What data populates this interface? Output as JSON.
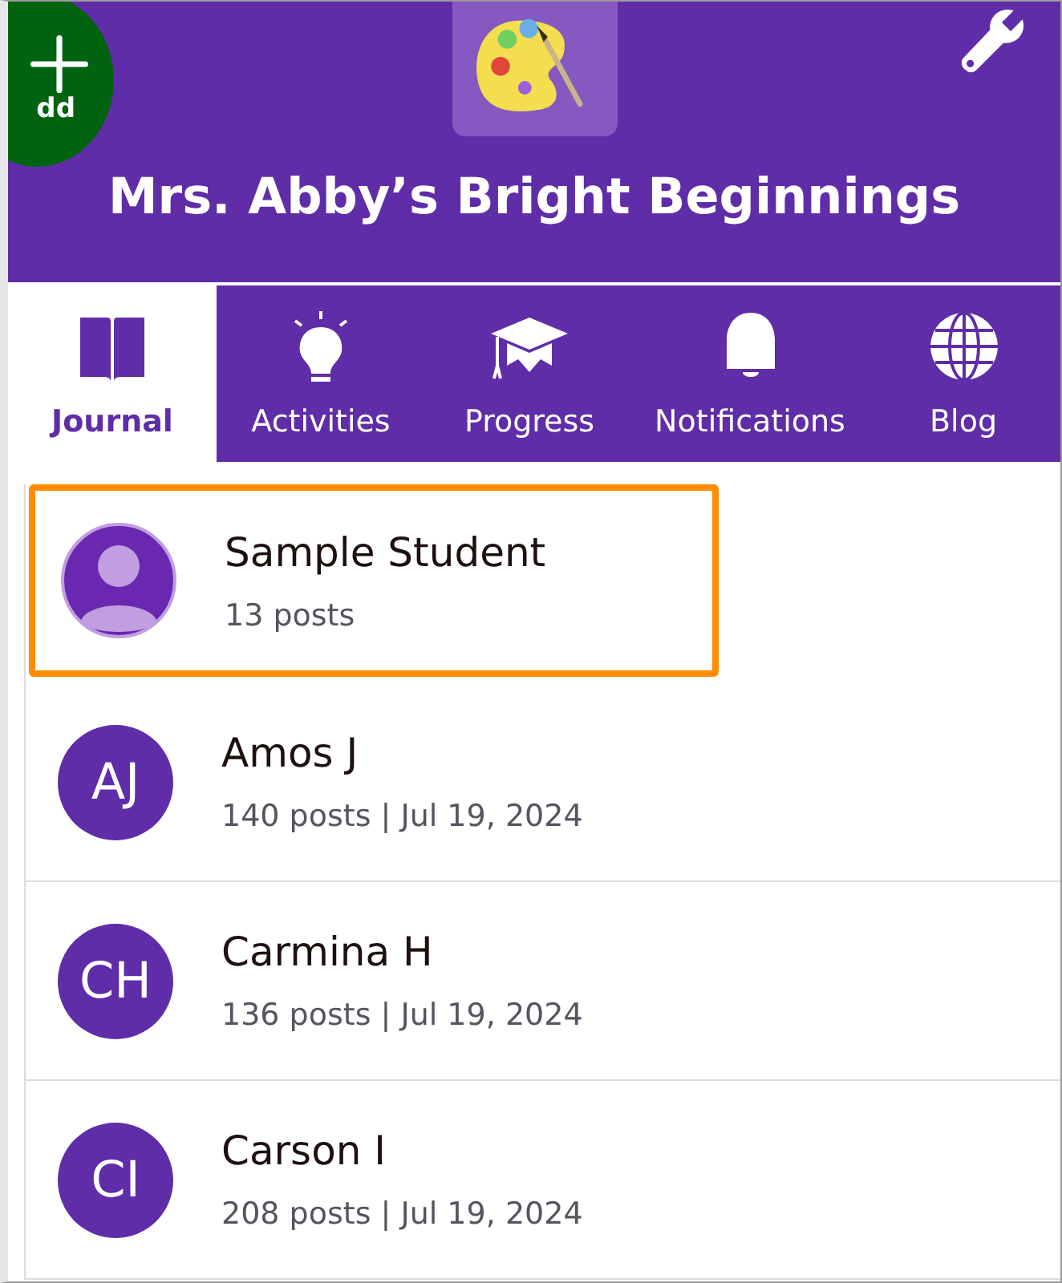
{
  "add_button": {
    "label": "dd"
  },
  "header": {
    "title": "Mrs. Abby’s Bright Beginnings"
  },
  "tabs": [
    {
      "label": "Journal",
      "kind": "book",
      "selected": true
    },
    {
      "label": "Activities",
      "kind": "bulb",
      "selected": false
    },
    {
      "label": "Progress",
      "kind": "cap",
      "selected": false
    },
    {
      "label": "Notifications",
      "kind": "bell",
      "selected": false
    },
    {
      "label": "Blog",
      "kind": "globe",
      "selected": false
    }
  ],
  "students": [
    {
      "name": "Sample Student",
      "detail": "13 posts",
      "kind": "placeholder",
      "selected": true
    },
    {
      "name": "Amos J",
      "detail": "140 posts | Jul 19, 2024",
      "kind": "initials",
      "initials": "AJ",
      "selected": false
    },
    {
      "name": "Carmina H",
      "detail": "136 posts | Jul 19, 2024",
      "kind": "initials",
      "initials": "CH",
      "selected": false
    },
    {
      "name": "Carson I",
      "detail": "208 posts | Jul 19, 2024",
      "kind": "initials",
      "initials": "CI",
      "selected": false
    }
  ]
}
